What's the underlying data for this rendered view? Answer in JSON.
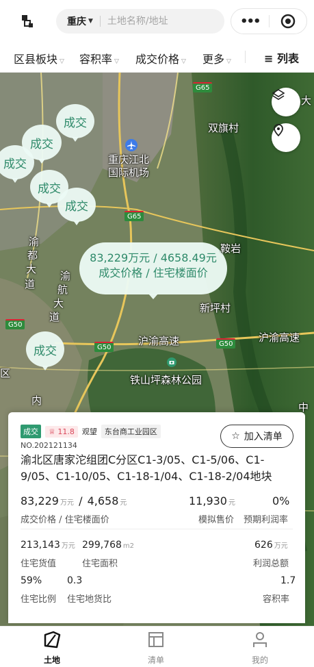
{
  "header": {
    "city": "重庆",
    "search_placeholder": "土地名称/地址",
    "more_icon": "more-dots-icon",
    "target_icon": "target-icon"
  },
  "filters": {
    "district": "区县板块",
    "far": "容积率",
    "price": "成交价格",
    "more": "更多",
    "list": "列表"
  },
  "map": {
    "bubbles": [
      "成交",
      "成交",
      "成交",
      "成交",
      "成交",
      "成交"
    ],
    "selected_bubble": {
      "line1": "83,229万元 / 4658.49元",
      "line2": "成交价格 / 住宅楼面价"
    },
    "labels": {
      "airport": "重庆江北",
      "airport2": "国际机场",
      "village1": "双旗村",
      "village2": "新坪村",
      "yan": "鞍岩",
      "da": "大",
      "park": "铁山坪森林公园",
      "hwy1": "沪渝高速",
      "hwy2": "沪渝高速",
      "yudu1": "渝",
      "yudu2": "都",
      "yudu3": "大",
      "yudu4": "道",
      "yuqi1": "渝",
      "yuqi2": "航",
      "yuqi3": "大",
      "yuqi4": "道",
      "nei": "内",
      "zhong": "中",
      "qu": "区"
    },
    "shields": [
      "G65",
      "G65",
      "G50",
      "G50",
      "G50"
    ]
  },
  "card": {
    "tag_deal": "成交",
    "heat": "11.8",
    "views": "观望",
    "area_tag": "东台商工业园区",
    "add_button": "加入清单",
    "number": "NO.202121134",
    "title": "渝北区唐家沱组团C分区C1-3/05、C1-5/06、C1-9/05、C1-10/05、C1-18-1/04、C1-18-2/04地块",
    "price_value": "83,229",
    "price_unit": "万元",
    "slash": "/",
    "floor_value": "4,658",
    "floor_unit": "元",
    "price_label": "成交价格",
    "floor_label": "住宅楼面价",
    "sim_price_value": "11,930",
    "sim_price_unit": "元",
    "sim_price_label": "模拟售价",
    "profit_rate_value": "0%",
    "profit_rate_label": "预期利润率",
    "res_value": "213,143",
    "res_value_unit": "万元",
    "res_value_label": "住宅货值",
    "res_area": "299,768",
    "res_area_unit": "m2",
    "res_area_label": "住宅面积",
    "profit_total": "626",
    "profit_total_unit": "万元",
    "profit_total_label": "利润总额",
    "res_ratio": "59%",
    "res_ratio_label": "住宅比例",
    "res_land_value": "0.3",
    "res_land_label": "住宅地货比",
    "far_value": "1.7",
    "far_label": "容积率"
  },
  "tabbar": {
    "tab1": "土地",
    "tab2": "清单",
    "tab3": "我的"
  },
  "colors": {
    "accent": "#2f9a70",
    "heat": "#d9465a"
  }
}
